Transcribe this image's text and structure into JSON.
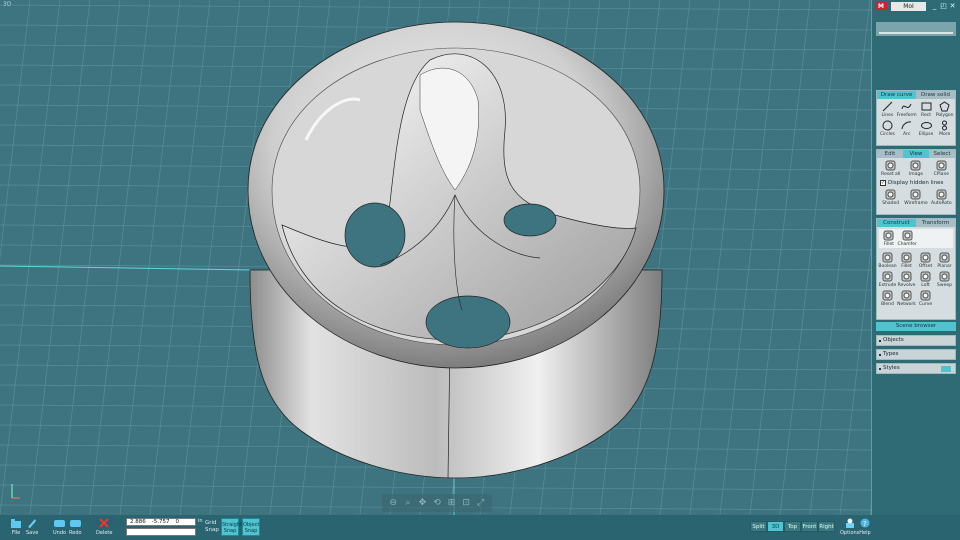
{
  "viewport": {
    "label": "3D"
  },
  "window": {
    "app_name": "MoI",
    "logo_text": "M",
    "minimize": "_",
    "restore": "◰",
    "close": "✕"
  },
  "draw_curve_panel": {
    "tabs": [
      "Draw curve",
      "Draw solid"
    ],
    "tools": [
      {
        "label": "Lines",
        "icon": "line-icon"
      },
      {
        "label": "Freeform",
        "icon": "freeform-icon"
      },
      {
        "label": "Rect",
        "icon": "rect-icon"
      },
      {
        "label": "Polygon",
        "icon": "polygon-icon"
      },
      {
        "label": "Circles",
        "icon": "circle-icon"
      },
      {
        "label": "Arc",
        "icon": "arc-icon"
      },
      {
        "label": "Ellipse",
        "icon": "ellipse-icon"
      },
      {
        "label": "More",
        "icon": "more-icon"
      }
    ]
  },
  "view_panel": {
    "tabs": [
      "Edit",
      "View",
      "Select"
    ],
    "tools": [
      {
        "label": "Reset all",
        "icon": "reset-icon"
      },
      {
        "label": "Image",
        "icon": "image-icon"
      },
      {
        "label": "CPlane",
        "icon": "cplane-icon"
      }
    ],
    "checkbox_label": "Display hidden lines",
    "tools2": [
      {
        "label": "Shaded",
        "icon": "shaded-icon"
      },
      {
        "label": "Wireframe",
        "icon": "wireframe-icon"
      },
      {
        "label": "AutoRoto",
        "icon": "autoroto-icon"
      }
    ]
  },
  "construct_panel": {
    "tabs": [
      "Construct",
      "Transform"
    ],
    "sub_tools": [
      {
        "label": "Fillet",
        "icon": "fillet-icon"
      },
      {
        "label": "Chamfer",
        "icon": "chamfer-icon"
      }
    ],
    "tools": [
      {
        "label": "Boolean",
        "icon": "boolean-icon"
      },
      {
        "label": "Fillet",
        "icon": "fillet2-icon"
      },
      {
        "label": "Offset",
        "icon": "offset-icon"
      },
      {
        "label": "Planar",
        "icon": "planar-icon"
      },
      {
        "label": "Extrude",
        "icon": "extrude-icon"
      },
      {
        "label": "Revolve",
        "icon": "revolve-icon"
      },
      {
        "label": "Loft",
        "icon": "loft-icon"
      },
      {
        "label": "Sweep",
        "icon": "sweep-icon"
      },
      {
        "label": "Blend",
        "icon": "blend-icon"
      },
      {
        "label": "Network",
        "icon": "network-icon"
      },
      {
        "label": "Curve",
        "icon": "curve-icon"
      }
    ]
  },
  "scene_browser": {
    "title": "Scene browser",
    "rows": [
      "Objects",
      "Types",
      "Styles"
    ]
  },
  "bottom": {
    "file": "File",
    "save": "Save",
    "undo": "Undo",
    "redo": "Redo",
    "delete": "Delete",
    "coord_x": "2.886",
    "coord_y": "-5.757",
    "coord_z": "0",
    "unit": "in",
    "grid_snap": "Grid Snap",
    "straight_snap": "Straight Snap",
    "object_snap": "Object Snap",
    "view_tabs": [
      "Split",
      "3D",
      "Top",
      "Front",
      "Right"
    ],
    "active_view": "3D",
    "options": "Options",
    "help": "Help"
  },
  "colors": {
    "accent": "#4fc3cf",
    "background": "#3d7480"
  }
}
